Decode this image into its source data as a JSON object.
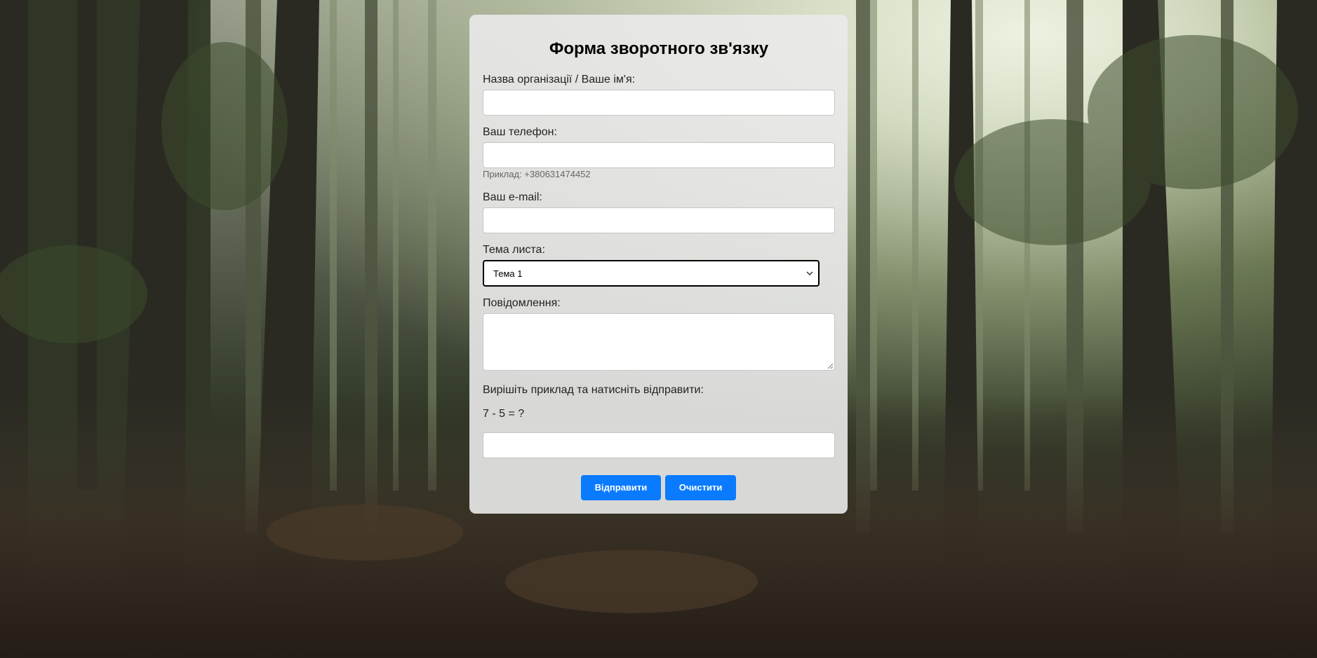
{
  "form": {
    "title": "Форма зворотного зв'язку",
    "name_label": "Назва організації / Ваше ім'я:",
    "name_value": "",
    "phone_label": "Ваш телефон:",
    "phone_value": "",
    "phone_hint": "Приклад: +380631474452",
    "email_label": "Ваш e-mail:",
    "email_value": "",
    "subject_label": "Тема листа:",
    "subject_selected": "Тема 1",
    "message_label": "Повідомлення:",
    "message_value": "",
    "captcha_label": "Вирішіть приклад та натисніть відправити:",
    "captcha_question": "7 - 5 = ?",
    "captcha_value": "",
    "submit_label": "Відправити",
    "clear_label": "Очистити"
  },
  "colors": {
    "button": "#0a7bff",
    "card": "#eaeaea"
  },
  "icons": {
    "select_arrow": "chevron-down-icon",
    "textarea_resize": "resize-handle-icon"
  }
}
